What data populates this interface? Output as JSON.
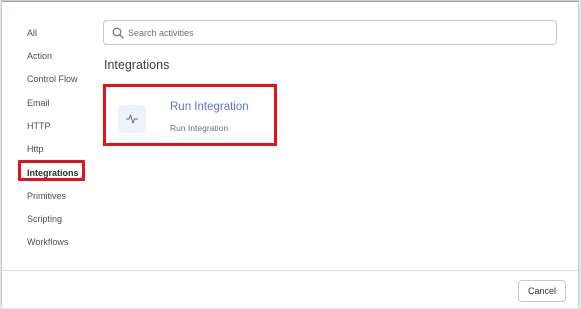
{
  "sidebar": {
    "items": [
      {
        "label": "All"
      },
      {
        "label": "Action"
      },
      {
        "label": "Control Flow"
      },
      {
        "label": "Email"
      },
      {
        "label": "HTTP"
      },
      {
        "label": "Http"
      },
      {
        "label": "Integrations",
        "active": true
      },
      {
        "label": "Primitives"
      },
      {
        "label": "Scripting"
      },
      {
        "label": "Workflows"
      }
    ]
  },
  "search": {
    "placeholder": "Search activities",
    "value": "",
    "icon": "search-icon"
  },
  "main": {
    "section_title": "Integrations",
    "cards": [
      {
        "title": "Run Integration",
        "description": "Run Integration",
        "icon": "activity-pulse-icon"
      }
    ]
  },
  "footer": {
    "cancel_label": "Cancel"
  },
  "colors": {
    "highlight": "#e0141c",
    "card_title": "#5b74d6",
    "icon_bg": "#eef3fb"
  }
}
